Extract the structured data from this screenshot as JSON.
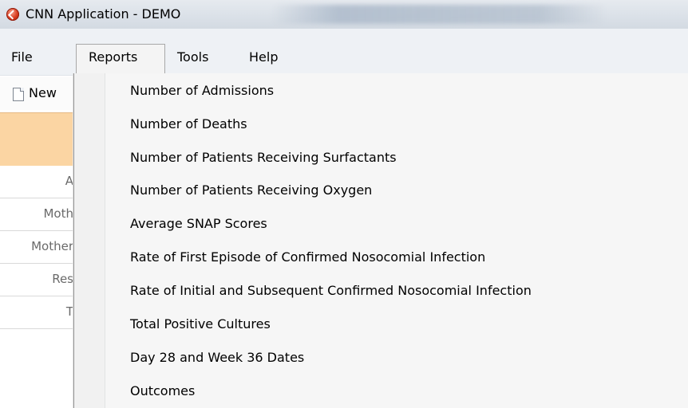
{
  "window": {
    "title": "CNN Application - DEMO",
    "icon": "app-logo-icon"
  },
  "menubar": {
    "items": [
      {
        "label": "File"
      },
      {
        "label": "Reports"
      },
      {
        "label": "Tools"
      },
      {
        "label": "Help"
      }
    ]
  },
  "toolbar": {
    "new_label": "New"
  },
  "background_rows": [
    {
      "label": "A"
    },
    {
      "label": "Moth"
    },
    {
      "label": "Mother"
    },
    {
      "label": "Res"
    },
    {
      "label": "T"
    }
  ],
  "reports_menu": {
    "items": [
      {
        "label": "Number of Admissions"
      },
      {
        "label": "Number of Deaths"
      },
      {
        "label": "Number of Patients Receiving Surfactants"
      },
      {
        "label": "Number of Patients Receiving Oxygen"
      },
      {
        "label": "Average SNAP Scores"
      },
      {
        "label": "Rate of First Episode of Confirmed Nosocomial Infection"
      },
      {
        "label": "Rate of Initial and Subsequent Confirmed Nosocomial Infection"
      },
      {
        "label": "Total Positive Cultures"
      },
      {
        "label": "Day 28 and Week 36 Dates"
      },
      {
        "label": "Outcomes"
      }
    ]
  }
}
